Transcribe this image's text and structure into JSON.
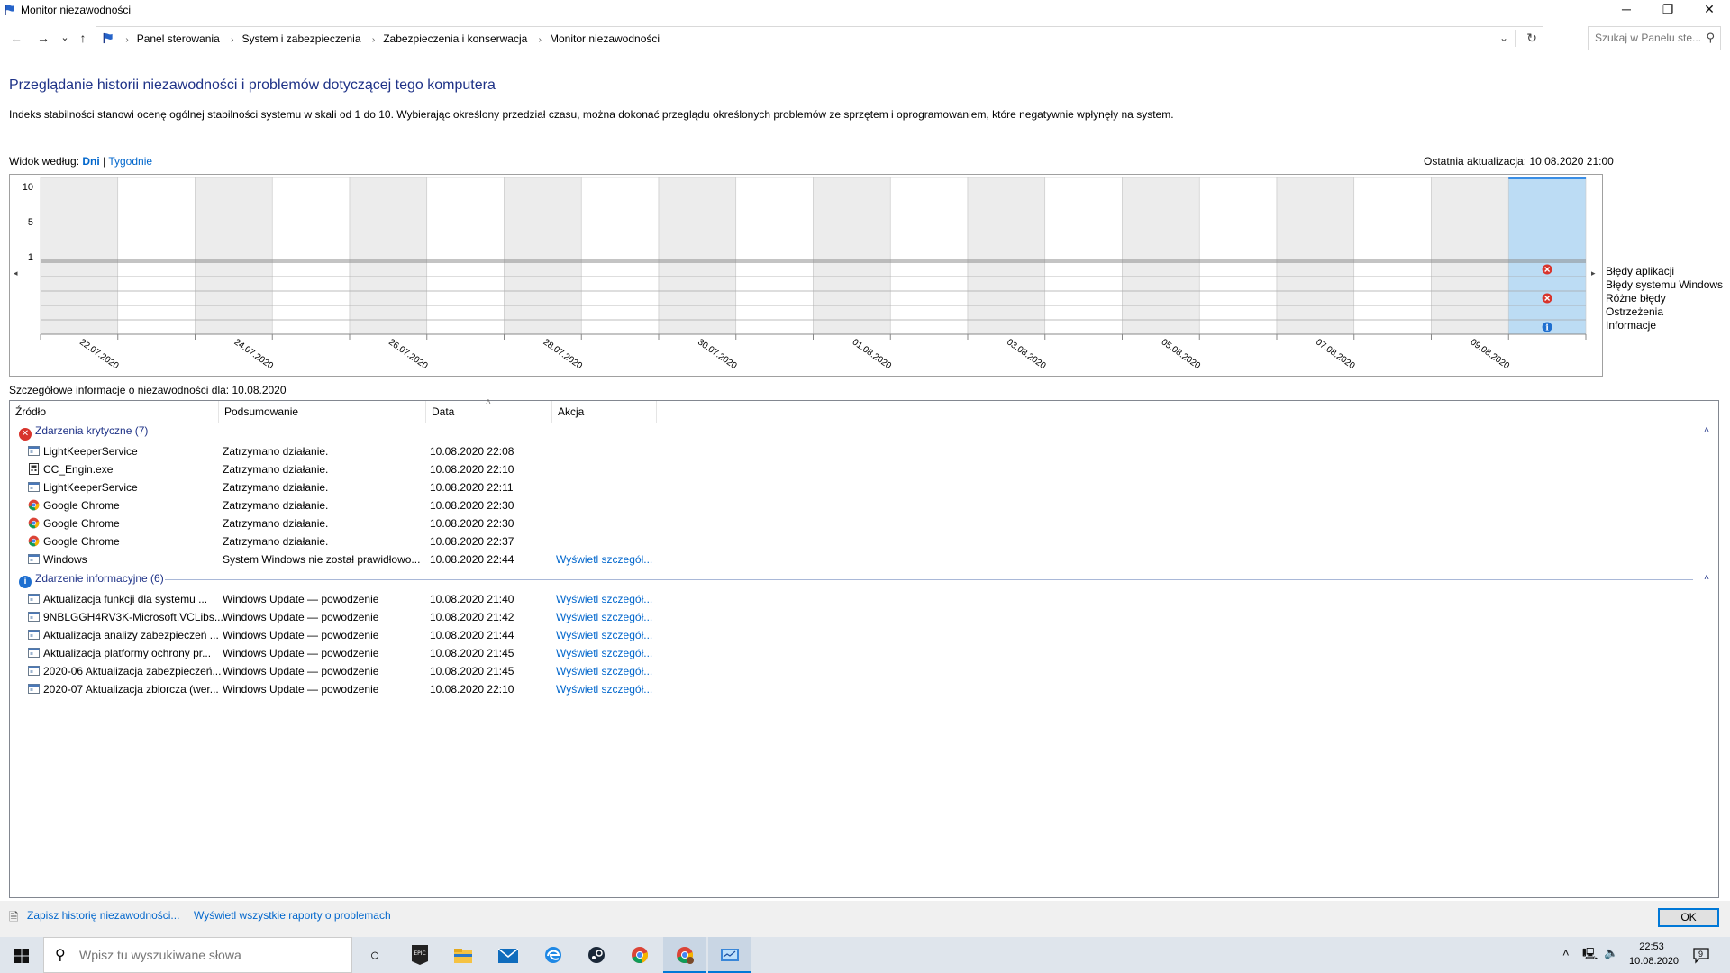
{
  "window": {
    "title": "Monitor niezawodności",
    "minimize": "─",
    "maximize": "❐",
    "close": "✕"
  },
  "nav": {
    "back": "←",
    "forward": "→",
    "recent": "⌄",
    "up": "↑",
    "breadcrumbs": [
      "Panel sterowania",
      "System i zabezpieczenia",
      "Zabezpieczenia i konserwacja",
      "Monitor niezawodności"
    ],
    "search_placeholder": "Szukaj w Panelu ste..."
  },
  "heading": "Przeglądanie historii niezawodności i problemów dotyczącej tego komputera",
  "description": "Indeks stabilności stanowi ocenę ogólnej stabilności systemu w skali od 1 do 10. Wybierając określony przedział czasu, można dokonać przeglądu określonych problemów ze sprzętem i oprogramowaniem, które negatywnie wpłynęły na system.",
  "view": {
    "label": "Widok według:",
    "days": "Dni",
    "separator": "|",
    "weeks": "Tygodnie",
    "last_update": "Ostatnia aktualizacja: 10.08.2020 21:00"
  },
  "chart": {
    "y_ticks": [
      "10",
      "5",
      "1"
    ],
    "dates": [
      "22.07.2020",
      "24.07.2020",
      "26.07.2020",
      "28.07.2020",
      "30.07.2020",
      "01.08.2020",
      "03.08.2020",
      "05.08.2020",
      "07.08.2020",
      "09.08.2020"
    ],
    "legend": [
      "Błędy aplikacji",
      "Błędy systemu Windows",
      "Różne błędy",
      "Ostrzeżenia",
      "Informacje"
    ],
    "selected_color": "#bcdcf4"
  },
  "chart_data": {
    "type": "table",
    "y_ticks": [
      "10",
      "5",
      "1"
    ],
    "x_ticks": [
      "22.07.2020",
      "24.07.2020",
      "26.07.2020",
      "28.07.2020",
      "30.07.2020",
      "01.08.2020",
      "03.08.2020",
      "05.08.2020",
      "07.08.2020",
      "09.08.2020"
    ],
    "rows": [
      "Błędy aplikacji",
      "Błędy systemu Windows",
      "Różne błędy",
      "Ostrzeżenia",
      "Informacje"
    ],
    "events": [
      {
        "day": "10.08.2020",
        "row": "Błędy aplikacji",
        "kind": "error"
      },
      {
        "day": "10.08.2020",
        "row": "Różne błędy",
        "kind": "error"
      },
      {
        "day": "10.08.2020",
        "row": "Informacje",
        "kind": "info"
      }
    ]
  },
  "details": {
    "label": "Szczegółowe informacje o niezawodności dla: 10.08.2020",
    "columns": [
      "Źródło",
      "Podsumowanie",
      "Data",
      "Akcja"
    ],
    "groups": [
      {
        "title": "Zdarzenia krytyczne (7)",
        "icon": "error",
        "rows": [
          {
            "icon": "service",
            "source": "LightKeeperService",
            "summary": "Zatrzymano działanie.",
            "date": "10.08.2020 22:08",
            "action": ""
          },
          {
            "icon": "exe",
            "source": "CC_Engin.exe",
            "summary": "Zatrzymano działanie.",
            "date": "10.08.2020 22:10",
            "action": ""
          },
          {
            "icon": "service",
            "source": "LightKeeperService",
            "summary": "Zatrzymano działanie.",
            "date": "10.08.2020 22:11",
            "action": ""
          },
          {
            "icon": "chrome",
            "source": "Google Chrome",
            "summary": "Zatrzymano działanie.",
            "date": "10.08.2020 22:30",
            "action": ""
          },
          {
            "icon": "chrome",
            "source": "Google Chrome",
            "summary": "Zatrzymano działanie.",
            "date": "10.08.2020 22:30",
            "action": ""
          },
          {
            "icon": "chrome",
            "source": "Google Chrome",
            "summary": "Zatrzymano działanie.",
            "date": "10.08.2020 22:37",
            "action": ""
          },
          {
            "icon": "service",
            "source": "Windows",
            "summary": "System Windows nie został prawidłowo...",
            "date": "10.08.2020 22:44",
            "action": "Wyświetl szczegół..."
          }
        ]
      },
      {
        "title": "Zdarzenie informacyjne (6)",
        "icon": "info",
        "rows": [
          {
            "icon": "service",
            "source": "Aktualizacja funkcji dla systemu ...",
            "summary": "Windows Update — powodzenie",
            "date": "10.08.2020 21:40",
            "action": "Wyświetl szczegół..."
          },
          {
            "icon": "service",
            "source": "9NBLGGH4RV3K-Microsoft.VCLibs...",
            "summary": "Windows Update — powodzenie",
            "date": "10.08.2020 21:42",
            "action": "Wyświetl szczegół..."
          },
          {
            "icon": "service",
            "source": "Aktualizacja analizy zabezpieczeń ...",
            "summary": "Windows Update — powodzenie",
            "date": "10.08.2020 21:44",
            "action": "Wyświetl szczegół..."
          },
          {
            "icon": "service",
            "source": "Aktualizacja platformy ochrony pr...",
            "summary": "Windows Update — powodzenie",
            "date": "10.08.2020 21:45",
            "action": "Wyświetl szczegół..."
          },
          {
            "icon": "service",
            "source": "2020-06 Aktualizacja zabezpieczeń...",
            "summary": "Windows Update — powodzenie",
            "date": "10.08.2020 21:45",
            "action": "Wyświetl szczegół..."
          },
          {
            "icon": "service",
            "source": "2020-07 Aktualizacja zbiorcza (wer...",
            "summary": "Windows Update — powodzenie",
            "date": "10.08.2020 22:10",
            "action": "Wyświetl szczegół..."
          }
        ]
      }
    ]
  },
  "bottom": {
    "save_history": "Zapisz historię niezawodności...",
    "view_all": "Wyświetl wszystkie raporty o problemach",
    "ok": "OK"
  },
  "taskbar": {
    "search_placeholder": "Wpisz tu wyszukiwane słowa",
    "time": "22:53",
    "date": "10.08.2020",
    "notification_count": "9",
    "apps": [
      "cortana-icon",
      "epic-games-icon",
      "file-explorer-icon",
      "mail-icon",
      "edge-icon",
      "steam-icon",
      "chrome-icon",
      "chrome-profile-icon",
      "reliability-monitor-icon"
    ]
  }
}
